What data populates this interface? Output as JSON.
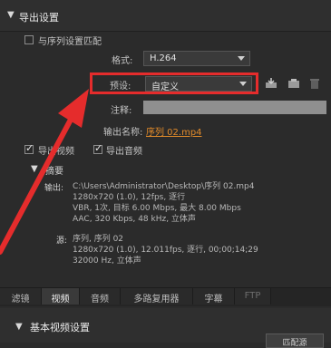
{
  "export_settings": {
    "title": "导出设置",
    "match_sequence_label": "与序列设置匹配",
    "format": {
      "label": "格式:",
      "value": "H.264"
    },
    "preset": {
      "label": "预设:",
      "value": "自定义"
    },
    "comments": {
      "label": "注释:",
      "value": ""
    },
    "output_name": {
      "label": "输出名称:",
      "value": "序列 02.mp4"
    },
    "export_video_label": "导出视频",
    "export_audio_label": "导出音频",
    "export_video_checked": true,
    "export_audio_checked": true
  },
  "summary": {
    "title": "摘要",
    "output_label": "输出:",
    "output_lines": [
      "C:\\Users\\Administrator\\Desktop\\序列 02.mp4",
      "1280x720 (1.0), 12fps, 逐行",
      "VBR, 1次, 目标 6.00 Mbps, 最大 8.00 Mbps",
      "AAC, 320 Kbps, 48 kHz, 立体声"
    ],
    "source_label": "源:",
    "source_lines": [
      "序列, 序列 02",
      "1280x720 (1.0), 12.011fps, 逐行, 00;00;14;29",
      "32000 Hz, 立体声"
    ]
  },
  "tabs": [
    {
      "label": "滤镜",
      "active": false,
      "disabled": false
    },
    {
      "label": "视频",
      "active": true,
      "disabled": false
    },
    {
      "label": "音频",
      "active": false,
      "disabled": false
    },
    {
      "label": "多路复用器",
      "active": false,
      "disabled": false
    },
    {
      "label": "字幕",
      "active": false,
      "disabled": false
    },
    {
      "label": "FTP",
      "active": false,
      "disabled": true
    }
  ],
  "basic_video": {
    "title": "基本视频设置",
    "match_source_button": "匹配源"
  },
  "colors": {
    "highlight": "#e52c2c",
    "orange_link": "#e08a2a"
  }
}
